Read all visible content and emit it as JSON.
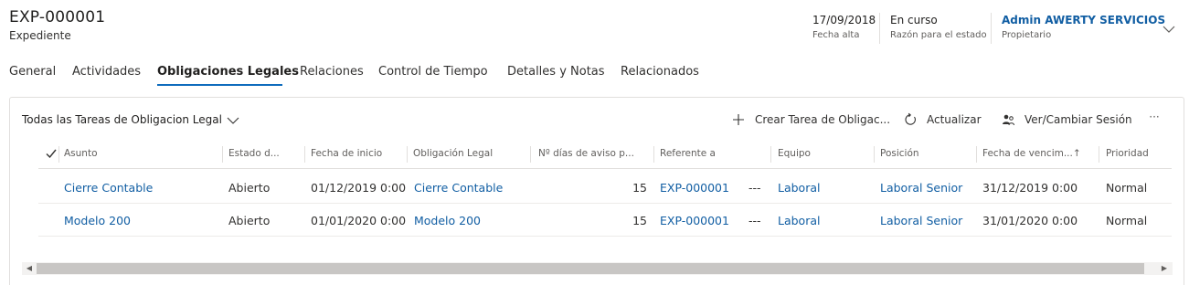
{
  "record": {
    "id": "EXP-000001",
    "entity": "Expediente"
  },
  "header_fields": [
    {
      "value": "17/09/2018",
      "label": "Fecha alta"
    },
    {
      "value": "En curso",
      "label": "Razón para el estado"
    },
    {
      "value": "Admin AWERTY SERVICIOS",
      "label": "Propietario"
    }
  ],
  "tabs": [
    {
      "label": "General"
    },
    {
      "label": "Actividades"
    },
    {
      "label": "Obligaciones Legales",
      "active": true
    },
    {
      "label": "Relaciones"
    },
    {
      "label": "Control de Tiempo"
    },
    {
      "label": "Detalles y Notas"
    },
    {
      "label": "Relacionados"
    }
  ],
  "subgrid": {
    "view_name": "Todas las Tareas de Obligacion Legal",
    "commands": {
      "create": "Crear Tarea de Obligac...",
      "refresh": "Actualizar",
      "session": "Ver/Cambiar Sesión",
      "more": "···"
    },
    "columns": [
      "Asunto",
      "Estado d...",
      "Fecha de inicio",
      "Obligación Legal",
      "Nº días de aviso p...",
      "Referente a",
      "Equipo",
      "Posición",
      "Fecha de vencim...↑",
      "Prioridad"
    ],
    "rows": [
      {
        "asunto": "Cierre Contable",
        "estado": "Abierto",
        "fecha_inicio": "01/12/2019 0:00",
        "obligacion": "Cierre Contable",
        "dias_aviso": "15",
        "referente": "EXP-000001",
        "sep": "---",
        "equipo": "Laboral",
        "posicion": "Laboral Senior",
        "fecha_venc": "31/12/2019 0:00",
        "prioridad": "Normal"
      },
      {
        "asunto": "Modelo 200",
        "estado": "Abierto",
        "fecha_inicio": "01/01/2020 0:00",
        "obligacion": "Modelo 200",
        "dias_aviso": "15",
        "referente": "EXP-000001",
        "sep": "---",
        "equipo": "Laboral",
        "posicion": "Laboral Senior",
        "fecha_venc": "31/01/2020 0:00",
        "prioridad": "Normal"
      }
    ]
  },
  "icons": {
    "chevron": "chevron-down-icon",
    "add": "add-icon",
    "refresh": "refresh-icon",
    "session": "users-icon",
    "check": "check-icon"
  },
  "colors": {
    "accent": "#0f6cbd",
    "link": "#115ea3"
  }
}
